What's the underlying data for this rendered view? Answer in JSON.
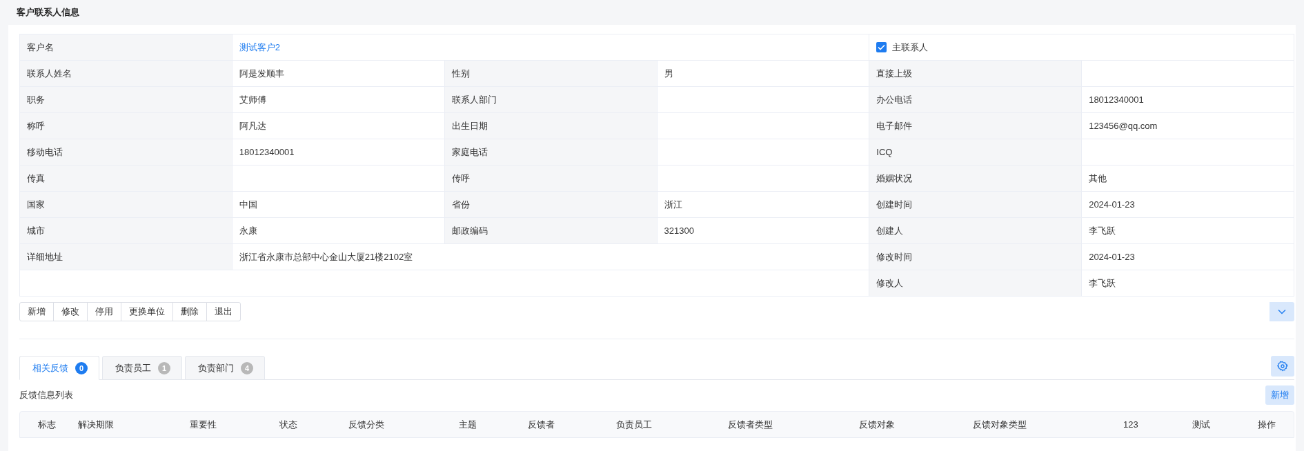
{
  "page_title": "客户联系人信息",
  "customer": {
    "label": "客户名",
    "value": "测试客户2",
    "primary_contact": {
      "label": "主联系人",
      "checked": true
    }
  },
  "rows": [
    [
      {
        "label": "联系人姓名",
        "value": "阿是发顺丰"
      },
      {
        "label": "性别",
        "value": "男"
      },
      {
        "label": "直接上级"
      }
    ],
    [
      {
        "label": "职务",
        "value": "艾师傅"
      },
      {
        "label": "联系人部门"
      },
      {
        "label": "办公电话",
        "value": "18012340001"
      }
    ],
    [
      {
        "label": "称呼",
        "value": "阿凡达"
      },
      {
        "label": "出生日期"
      },
      {
        "label": "电子邮件",
        "value": "123456@qq.com"
      }
    ],
    [
      {
        "label": "移动电话",
        "value": "18012340001"
      },
      {
        "label": "家庭电话"
      },
      {
        "label": "ICQ"
      }
    ],
    [
      {
        "label": "传真"
      },
      {
        "label": "传呼"
      },
      {
        "label": "婚姻状况",
        "value": "其他"
      }
    ],
    [
      {
        "label": "国家",
        "value": "中国"
      },
      {
        "label": "省份",
        "value": "浙江"
      },
      {
        "label": "创建时间",
        "value": "2024-01-23"
      }
    ],
    [
      {
        "label": "城市",
        "value": "永康"
      },
      {
        "label": "邮政编码",
        "value": "321300"
      },
      {
        "label": "创建人",
        "value": "李飞跃"
      }
    ]
  ],
  "address": {
    "label": "详细地址",
    "value": "浙江省永康市总部中心金山大厦21楼2102室"
  },
  "address_side": {
    "label": "修改时间",
    "value": "2024-01-23"
  },
  "last_row": {
    "label": "修改人",
    "value": "李飞跃"
  },
  "actions": [
    "新增",
    "修改",
    "停用",
    "更换单位",
    "删除",
    "退出"
  ],
  "tabs": [
    {
      "label": "相关反馈",
      "count": "0",
      "selected": true
    },
    {
      "label": "负责员工",
      "count": "1",
      "selected": false
    },
    {
      "label": "负责部门",
      "count": "4",
      "selected": false
    }
  ],
  "list_title": "反馈信息列表",
  "add_button": "新增",
  "table": {
    "columns": [
      "标志",
      "解决期限",
      "重要性",
      "状态",
      "反馈分类",
      "主题",
      "反馈者",
      "负责员工",
      "反馈者类型",
      "反馈对象",
      "反馈对象类型",
      "123",
      "测试",
      "操作"
    ]
  }
}
